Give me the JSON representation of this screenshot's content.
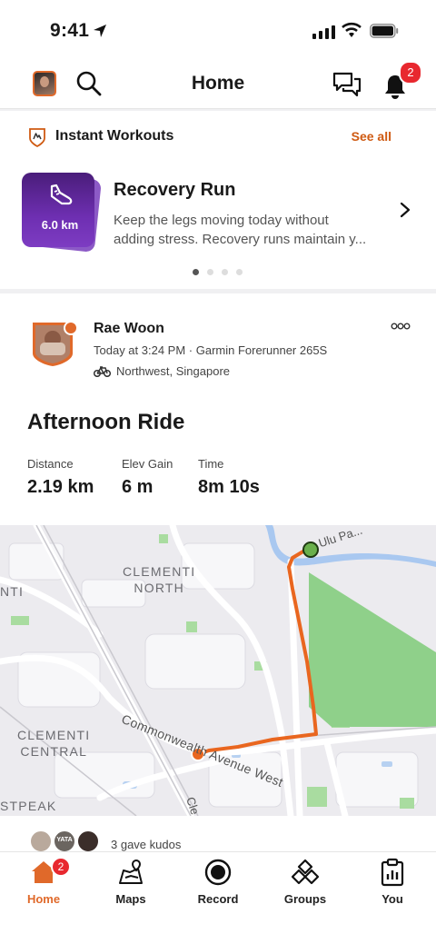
{
  "status_bar": {
    "time": "9:41"
  },
  "header": {
    "title": "Home",
    "notifications_count": "2"
  },
  "instant_workouts": {
    "title": "Instant Workouts",
    "see_all": "See all",
    "card": {
      "distance": "6.0 km",
      "name": "Recovery Run",
      "description_line1": "Keep the legs moving today without",
      "description_line2": "adding stress. Recovery runs maintain y..."
    },
    "pager": {
      "count": 4,
      "active_index": 0
    }
  },
  "activity": {
    "athlete": "Rae Woon",
    "meta": "Today at 3:24 PM · Garmin Forerunner 265S",
    "location": "Northwest, Singapore",
    "title": "Afternoon Ride",
    "stats": [
      {
        "label": "Distance",
        "value": "2.19 km"
      },
      {
        "label": "Elev Gain",
        "value": "6 m"
      },
      {
        "label": "Time",
        "value": "8m 10s"
      }
    ],
    "map": {
      "labels": {
        "clementi_north_1": "CLEMENTI",
        "clementi_north_2": "NORTH",
        "clementi_central_1": "CLEMENTI",
        "clementi_central_2": "CENTRAL",
        "road": "Commonwealth Avenue West",
        "ulu": "Ulu Pa...",
        "nti": "NTI",
        "stpeak": "STPEAK",
        "cle": "Cle"
      },
      "colors": {
        "route": "#e9661f",
        "start": "#6ab04c",
        "end": "#e9661f",
        "park": "#8fd08a"
      }
    },
    "kudos": "3 gave kudos",
    "kudos_avatar_text": "YATA"
  },
  "tabbar": {
    "tabs": [
      {
        "label": "Home",
        "icon": "home-icon",
        "active": true,
        "badge": "2"
      },
      {
        "label": "Maps",
        "icon": "maps-icon"
      },
      {
        "label": "Record",
        "icon": "record-icon"
      },
      {
        "label": "Groups",
        "icon": "groups-icon"
      },
      {
        "label": "You",
        "icon": "you-icon"
      }
    ]
  },
  "colors": {
    "accent": "#e0692a",
    "badge": "#e8282f",
    "link": "#cf5a12"
  }
}
